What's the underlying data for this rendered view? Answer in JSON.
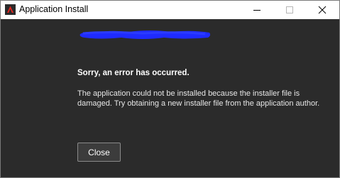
{
  "window": {
    "title": "Application Install",
    "icon": "adobe-air-icon",
    "controls": [
      "minimize-icon",
      "maximize-icon",
      "close-icon"
    ]
  },
  "dialog": {
    "heading": "Sorry, an error has occurred.",
    "message": "The application could not be installed because the installer file is damaged. Try obtaining a new installer file from the application author.",
    "close_label": "Close",
    "redaction_color": "#1f2bff"
  },
  "colors": {
    "background": "#2b2b2b",
    "titlebar": "#ffffff",
    "button_border": "#8a8a8a"
  }
}
